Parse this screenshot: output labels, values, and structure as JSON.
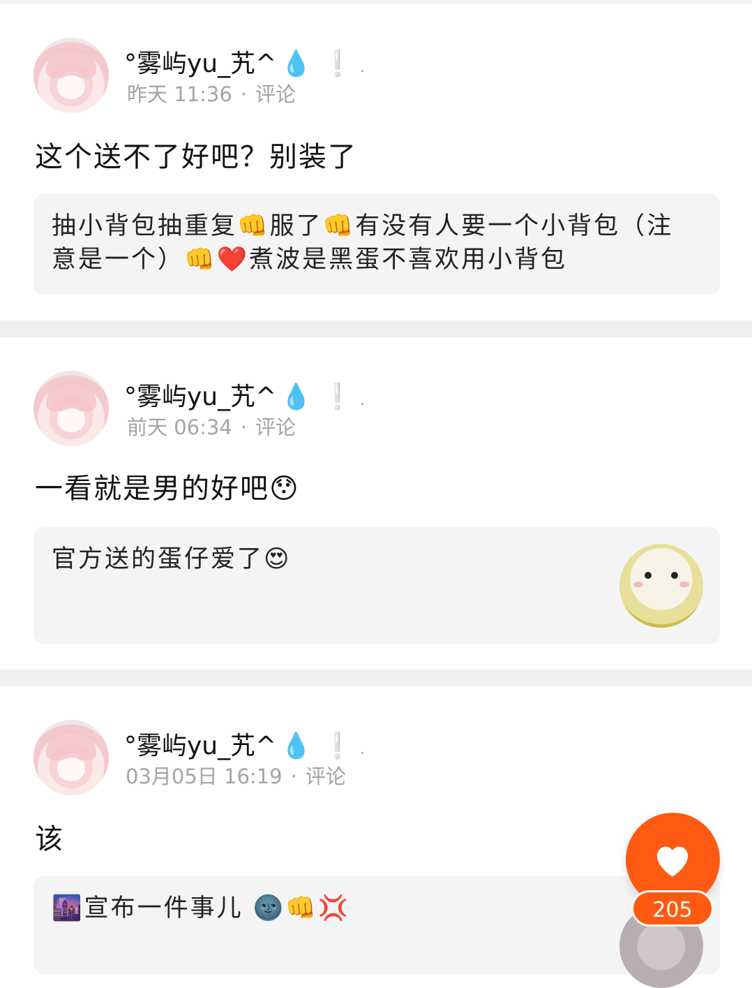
{
  "posts": [
    {
      "username": "°雾屿yu_艽^",
      "name_deco": "💧",
      "name_excl": "❕",
      "name_dot": ".",
      "time": "昨天 11:36",
      "separator": "·",
      "comment_link": "评论",
      "comment": "这个送不了好吧？别装了",
      "quoted_text": "抽小背包抽重复👊服了👊有没有人要一个小背包（注意是一个）👊❤️煮波是黑蛋不喜欢用小背包"
    },
    {
      "username": "°雾屿yu_艽^",
      "name_deco": "💧",
      "name_excl": "❕",
      "name_dot": ".",
      "time": "前天 06:34",
      "separator": "·",
      "comment_link": "评论",
      "comment": "一看就是男的好吧😯",
      "quoted_text": "官方送的蛋仔爱了😍"
    },
    {
      "username": "°雾屿yu_艽^",
      "name_deco": "💧",
      "name_excl": "❕",
      "name_dot": ".",
      "time": "03月05日 16:19",
      "separator": "·",
      "comment_link": "评论",
      "comment": "该",
      "quoted_text": "🌆宣布一件事儿  🌚👊💢"
    }
  ],
  "like": {
    "icon": "heart-icon",
    "count": "205"
  },
  "colors": {
    "accent": "#ff5a12",
    "divider": "#f0f0f0",
    "quote_bg": "#f4f4f4",
    "meta_text": "#a4a4a4"
  }
}
